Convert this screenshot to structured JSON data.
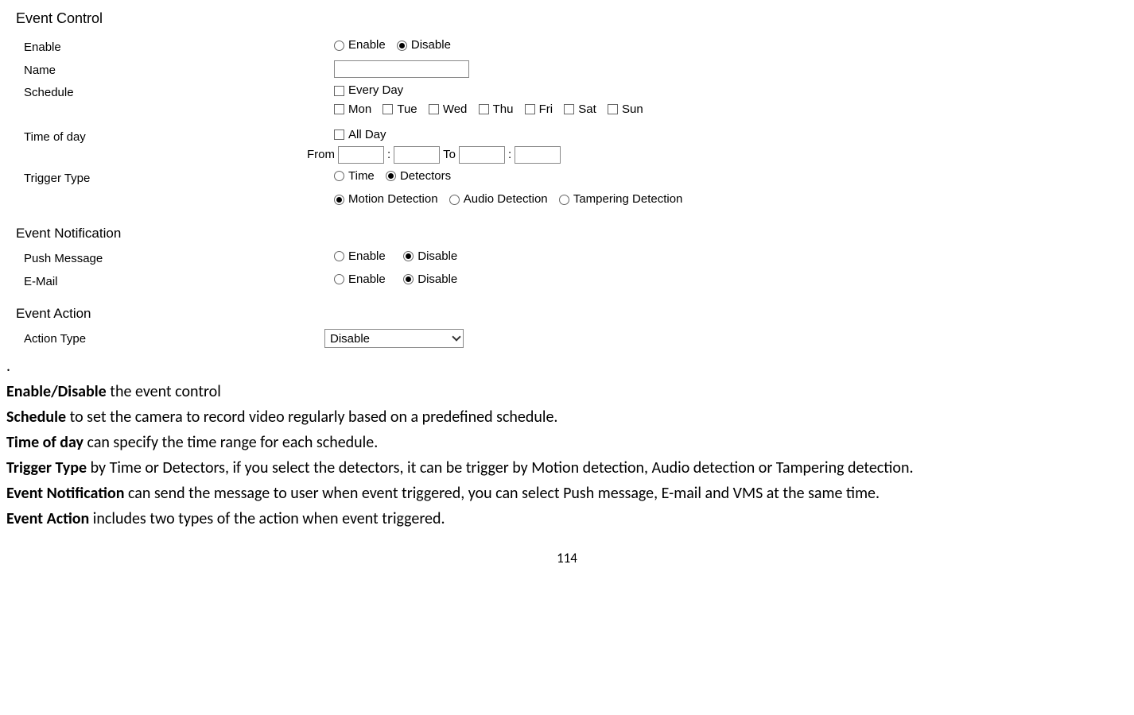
{
  "eventControl": {
    "title": "Event Control",
    "enable": {
      "label": "Enable",
      "options": {
        "enable": "Enable",
        "disable": "Disable"
      },
      "selected": "disable"
    },
    "name": {
      "label": "Name",
      "value": ""
    },
    "schedule": {
      "label": "Schedule",
      "everyDay": "Every Day",
      "days": {
        "mon": "Mon",
        "tue": "Tue",
        "wed": "Wed",
        "thu": "Thu",
        "fri": "Fri",
        "sat": "Sat",
        "sun": "Sun"
      }
    },
    "timeOfDay": {
      "label": "Time of day",
      "allDay": "All Day",
      "from": "From",
      "to": "To",
      "colon": ":"
    },
    "triggerType": {
      "label": "Trigger Type",
      "options": {
        "time": "Time",
        "detectors": "Detectors"
      },
      "selected": "detectors",
      "detectOptions": {
        "motion": "Motion Detection",
        "audio": "Audio Detection",
        "tampering": "Tampering Detection"
      },
      "detectSelected": "motion"
    }
  },
  "eventNotification": {
    "title": "Event Notification",
    "pushMessage": {
      "label": "Push Message",
      "options": {
        "enable": "Enable",
        "disable": "Disable"
      },
      "selected": "disable"
    },
    "email": {
      "label": "E-Mail",
      "options": {
        "enable": "Enable",
        "disable": "Disable"
      },
      "selected": "disable"
    }
  },
  "eventAction": {
    "title": "Event Action",
    "actionType": {
      "label": "Action Type",
      "value": "Disable"
    }
  },
  "description": {
    "period": ".",
    "line1_bold": "Enable/Disable",
    "line1_rest": " the event control",
    "line2_bold": "Schedule",
    "line2_rest": " to set the camera to record video regularly based on a predefined schedule.",
    "line3_bold": "Time of day",
    "line3_rest": " can specify the time range for each schedule.",
    "line4_bold": "Trigger Type",
    "line4_rest": " by Time or Detectors, if you select the detectors, it can be trigger by Motion detection, Audio detection or Tampering detection.",
    "line5_bold": "Event Notification",
    "line5_rest": " can send the message to user when event triggered, you can select Push message, E-mail and VMS at the same time.",
    "line6_bold": "Event Action",
    "line6_rest": " includes two types of the action when event triggered."
  },
  "pageNumber": "114"
}
